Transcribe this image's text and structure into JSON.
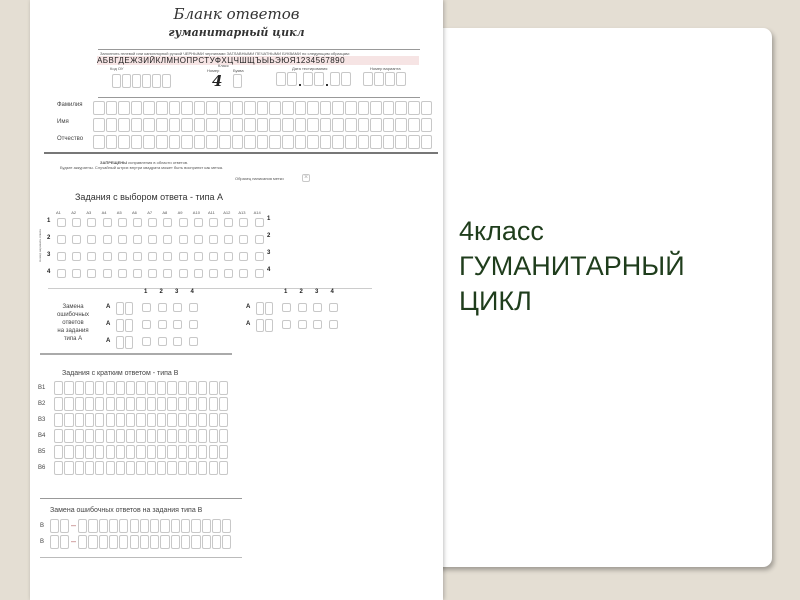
{
  "slide": {
    "line1": "4класс",
    "line2": "ГУМАНИТАРНЫЙ",
    "line3": "ЦИКЛ",
    "text_color": "#1f3d1c",
    "background": "#e4ded3"
  },
  "sheet": {
    "title": "Бланк ответов",
    "subtitle": "гуманитарный цикл",
    "instruction": "Заполнять гелевой или капиллярной ручкой ЧЕРНЫМИ чернилами ЗАГЛАВНЫМИ ПЕЧАТНЫМИ БУКВАМИ по следующим образцам:",
    "alphabet": "АБВГДЕЖЗИЙКЛМНОПРСТУФХЦЧШЩЪЫЬЭЮЯ1234567890",
    "fields": {
      "school_code": "Код ОУ",
      "class": "Класс",
      "number": "Номер",
      "letter": "Буква",
      "class_number_value": "4",
      "test_date": "Дата тестирования",
      "variant": "Номер варианта"
    },
    "name_rows": [
      "Фамилия",
      "Имя",
      "Отчество"
    ],
    "warning_bold": "ЗАПРЕЩЕНЫ",
    "warning_rest": "исправления в области ответов.",
    "warning_line2": "Будьте аккуратны. Случайный штрих внутри квадрата может быть воспринят как метка.",
    "mark_sample": "Образец написания метки",
    "section_a": {
      "title": "Задания с выбором ответа - типа А",
      "columns": [
        "A1",
        "A2",
        "A3",
        "A4",
        "A5",
        "A6",
        "A7",
        "A8",
        "A9",
        "A10",
        "A11",
        "A12",
        "A13",
        "A14"
      ],
      "rows": [
        "1",
        "2",
        "3",
        "4"
      ],
      "side_label": "Номер варианта ответа"
    },
    "replace_a": {
      "label": [
        "Замена",
        "ошибочных",
        "ответов",
        "на задания",
        "типа А"
      ],
      "letter": "A",
      "options": [
        "1",
        "2",
        "3",
        "4"
      ]
    },
    "section_b": {
      "title": "Задания с кратким ответом - типа В",
      "rows": [
        "B1",
        "B2",
        "B3",
        "B4",
        "B5",
        "B6"
      ]
    },
    "replace_b": {
      "title": "Замена ошибочных ответов на задания типа В",
      "letter": "B",
      "dash": "–"
    }
  }
}
